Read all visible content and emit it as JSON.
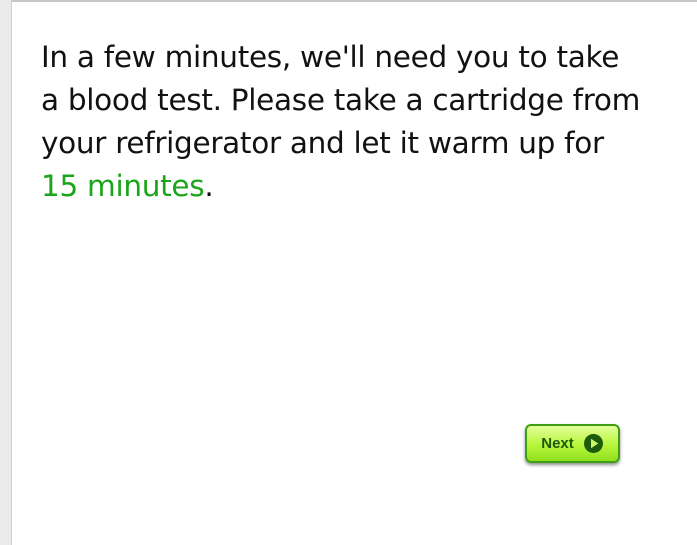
{
  "message": {
    "text_before": "In a few minutes, we'll need you to take a blood test. Please take a cartridge from your refrigerator and let it warm up for ",
    "highlight": "15 minutes",
    "text_after": "."
  },
  "next_button": {
    "label": "Next",
    "icon": "play-circle-icon"
  },
  "colors": {
    "highlight": "#1aa51a",
    "button_fill": "#b6f53b",
    "button_border": "#3f9f12",
    "button_text": "#1d5a0b"
  }
}
